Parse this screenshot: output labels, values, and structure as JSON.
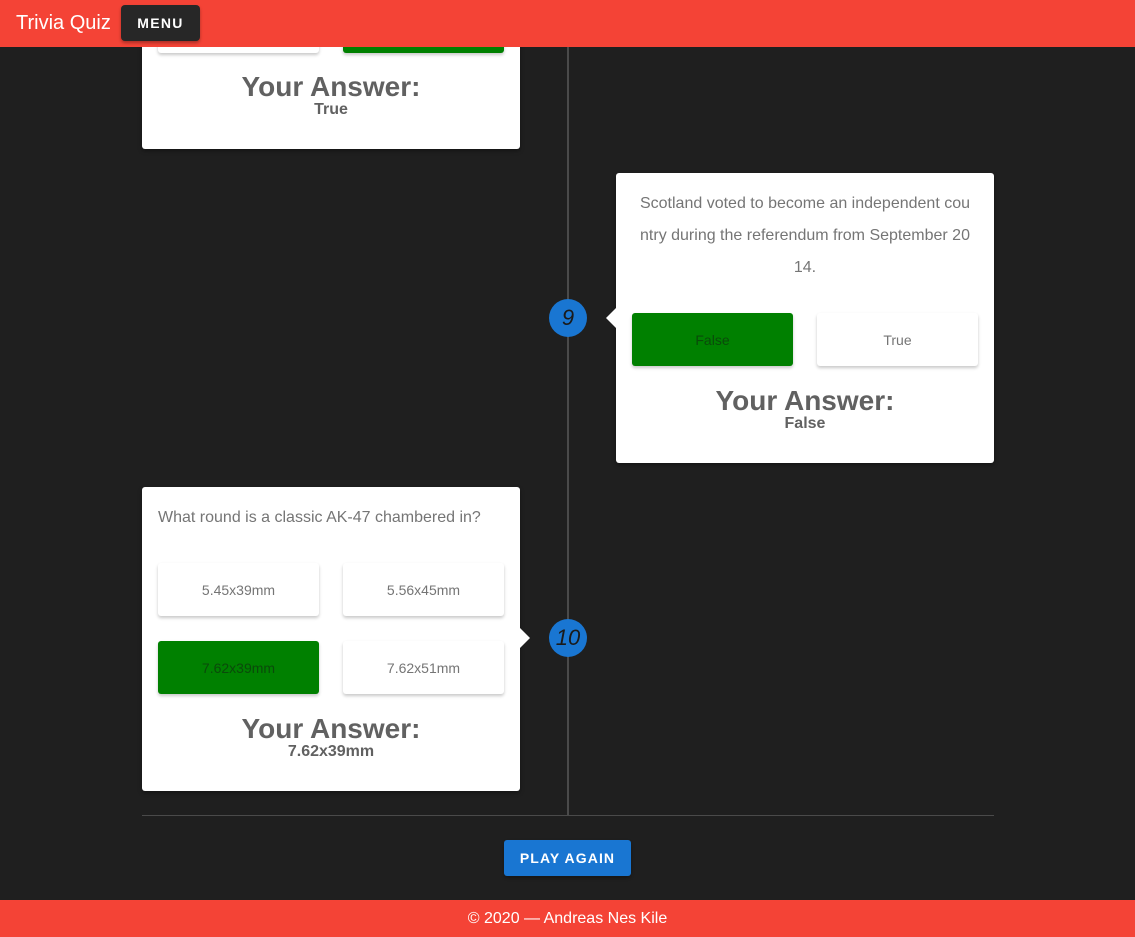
{
  "header": {
    "title": "Trivia Quiz",
    "menu_label": "MENU"
  },
  "colors": {
    "appbar": "#f44336",
    "background": "#1f1f1f",
    "selected_answer": "#008000",
    "accent": "#1976d2"
  },
  "previous_card": {
    "answer_heading": "Your Answer:",
    "answer_value": "True"
  },
  "questions": [
    {
      "number": "9",
      "text": "Scotland voted to become an independent country during the referendum from September 2014.",
      "text_lines": [
        "Scotland voted to become an independent cou",
        "ntry during the referendum from September 20",
        "14."
      ],
      "options": [
        "False",
        "True"
      ],
      "selected": "False",
      "answer_heading": "Your Answer:",
      "answer_value": "False"
    },
    {
      "number": "10",
      "text": "What round is a classic AK-47 chambered in?",
      "options": [
        "5.45x39mm",
        "5.56x45mm",
        "7.62x39mm",
        "7.62x51mm"
      ],
      "selected": "7.62x39mm",
      "answer_heading": "Your Answer:",
      "answer_value": "7.62x39mm"
    }
  ],
  "play_again_label": "PLAY AGAIN",
  "footer": {
    "text": "© 2020 — Andreas Nes Kile"
  }
}
